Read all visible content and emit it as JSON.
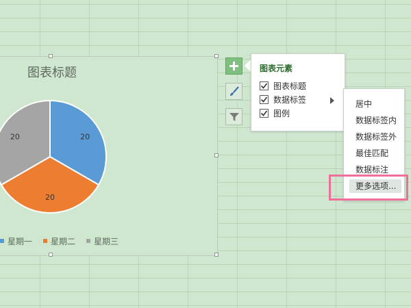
{
  "chart": {
    "title": "图表标题",
    "legend": [
      {
        "label": "星期一",
        "color": "#5b9bd5"
      },
      {
        "label": "星期二",
        "color": "#ed7d31"
      },
      {
        "label": "星期三",
        "color": "#a5a5a5"
      }
    ]
  },
  "chart_data": {
    "type": "pie",
    "title": "图表标题",
    "categories": [
      "星期一",
      "星期二",
      "星期三"
    ],
    "values": [
      20,
      20,
      20
    ],
    "colors": [
      "#5b9bd5",
      "#ed7d31",
      "#a5a5a5"
    ],
    "data_labels": [
      "20",
      "20",
      "20"
    ],
    "legend_position": "bottom"
  },
  "side_buttons": [
    {
      "name": "plus-icon",
      "active": true
    },
    {
      "name": "brush-icon",
      "active": false
    },
    {
      "name": "filter-icon",
      "active": false
    }
  ],
  "flyout": {
    "title": "图表元素",
    "items": [
      {
        "label": "图表标题",
        "checked": true
      },
      {
        "label": "数据标签",
        "checked": true
      },
      {
        "label": "图例",
        "checked": true
      }
    ]
  },
  "submenu": {
    "items": [
      "居中",
      "数据标签内",
      "数据标签外",
      "最佳匹配",
      "数据标注",
      "更多选项..."
    ],
    "highlighted_index": 5
  },
  "colors": {
    "background": "#cfe6cf",
    "accent": "#7fbf7f",
    "highlight_border": "#ef6f9a"
  }
}
